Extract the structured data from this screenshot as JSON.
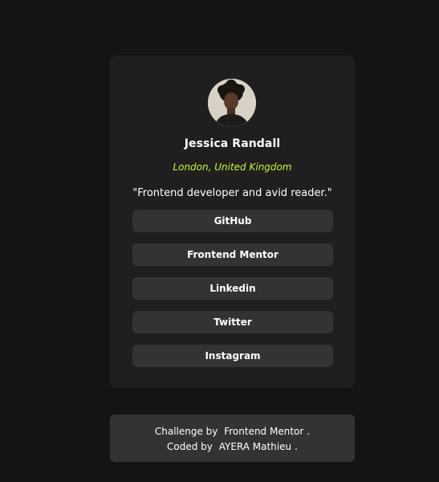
{
  "profile": {
    "name": "Jessica Randall",
    "location": "London, United Kingdom",
    "bio": "\"Frontend developer and avid reader.\"",
    "avatar_icon": "profile-photo"
  },
  "links": [
    {
      "label": "GitHub"
    },
    {
      "label": "Frontend Mentor"
    },
    {
      "label": "Linkedin"
    },
    {
      "label": "Twitter"
    },
    {
      "label": "Instagram"
    }
  ],
  "footer": {
    "challenge_prefix": "Challenge by",
    "challenge_link": "Frontend Mentor",
    "challenge_suffix": ".",
    "coded_prefix": "Coded by",
    "coded_link": "AYERA Mathieu",
    "coded_suffix": "."
  },
  "colors": {
    "background": "#141414",
    "card": "#1f1f1f",
    "button": "#333333",
    "accent": "#c4f82a",
    "text": "#ffffff"
  }
}
